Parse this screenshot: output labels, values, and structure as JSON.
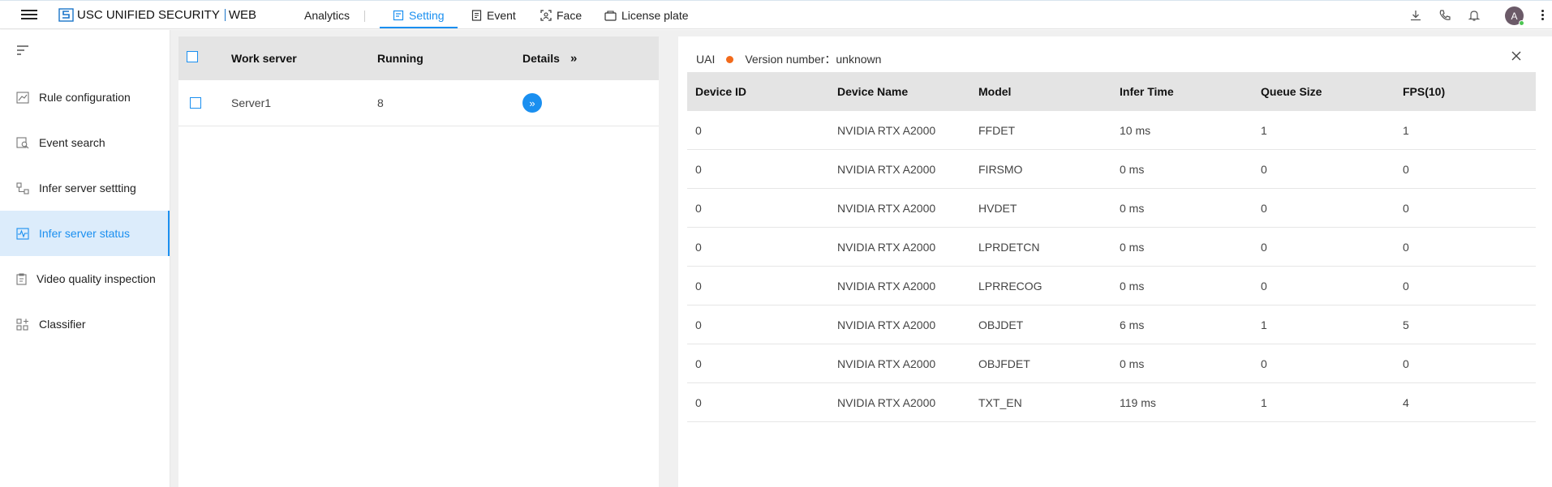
{
  "topbar": {
    "app_name": "USC UNIFIED SECURITY",
    "app_suffix": "WEB",
    "nav": [
      {
        "label": "Analytics",
        "icon": "none"
      },
      {
        "label": "Setting",
        "icon": "setting-icon"
      },
      {
        "label": "Event",
        "icon": "event-icon"
      },
      {
        "label": "Face",
        "icon": "face-icon"
      },
      {
        "label": "License plate",
        "icon": "license-plate-icon"
      }
    ],
    "active_nav": "Setting",
    "avatar_letter": "A"
  },
  "sidebar": {
    "items": [
      {
        "label": "Rule configuration",
        "icon": "rule-icon"
      },
      {
        "label": "Event search",
        "icon": "event-search-icon"
      },
      {
        "label": "Infer server settting",
        "icon": "server-setting-icon"
      },
      {
        "label": "Infer server status",
        "icon": "status-icon"
      },
      {
        "label": "Video quality inspection",
        "icon": "video-quality-icon"
      },
      {
        "label": "Classifier",
        "icon": "classifier-icon"
      }
    ],
    "active_item": "Infer server status"
  },
  "servers": {
    "headers": {
      "name": "Work server",
      "running": "Running",
      "details": "Details",
      "details_icon": "»"
    },
    "rows": [
      {
        "name": "Server1",
        "running": "8",
        "details_icon": "»"
      }
    ]
  },
  "detail": {
    "name": "UAI",
    "version_label": "Version number：unknown",
    "status_color": "#f26a1b",
    "headers": [
      "Device ID",
      "Device Name",
      "Model",
      "Infer Time",
      "Queue Size",
      "FPS(10)"
    ],
    "rows": [
      [
        "0",
        "NVIDIA RTX A2000",
        "FFDET",
        "10 ms",
        "1",
        "1"
      ],
      [
        "0",
        "NVIDIA RTX A2000",
        "FIRSMO",
        "0 ms",
        "0",
        "0"
      ],
      [
        "0",
        "NVIDIA RTX A2000",
        "HVDET",
        "0 ms",
        "0",
        "0"
      ],
      [
        "0",
        "NVIDIA RTX A2000",
        "LPRDETCN",
        "0 ms",
        "0",
        "0"
      ],
      [
        "0",
        "NVIDIA RTX A2000",
        "LPRRECOG",
        "0 ms",
        "0",
        "0"
      ],
      [
        "0",
        "NVIDIA RTX A2000",
        "OBJDET",
        "6 ms",
        "1",
        "5"
      ],
      [
        "0",
        "NVIDIA RTX A2000",
        "OBJFDET",
        "0 ms",
        "0",
        "0"
      ],
      [
        "0",
        "NVIDIA RTX A2000",
        "TXT_EN",
        "119 ms",
        "1",
        "4"
      ]
    ]
  },
  "colors": {
    "accent": "#1a8ff0",
    "active_bg": "#dcecfb",
    "header_bg": "#e4e4e4",
    "content_bg": "#f0f0f0"
  }
}
